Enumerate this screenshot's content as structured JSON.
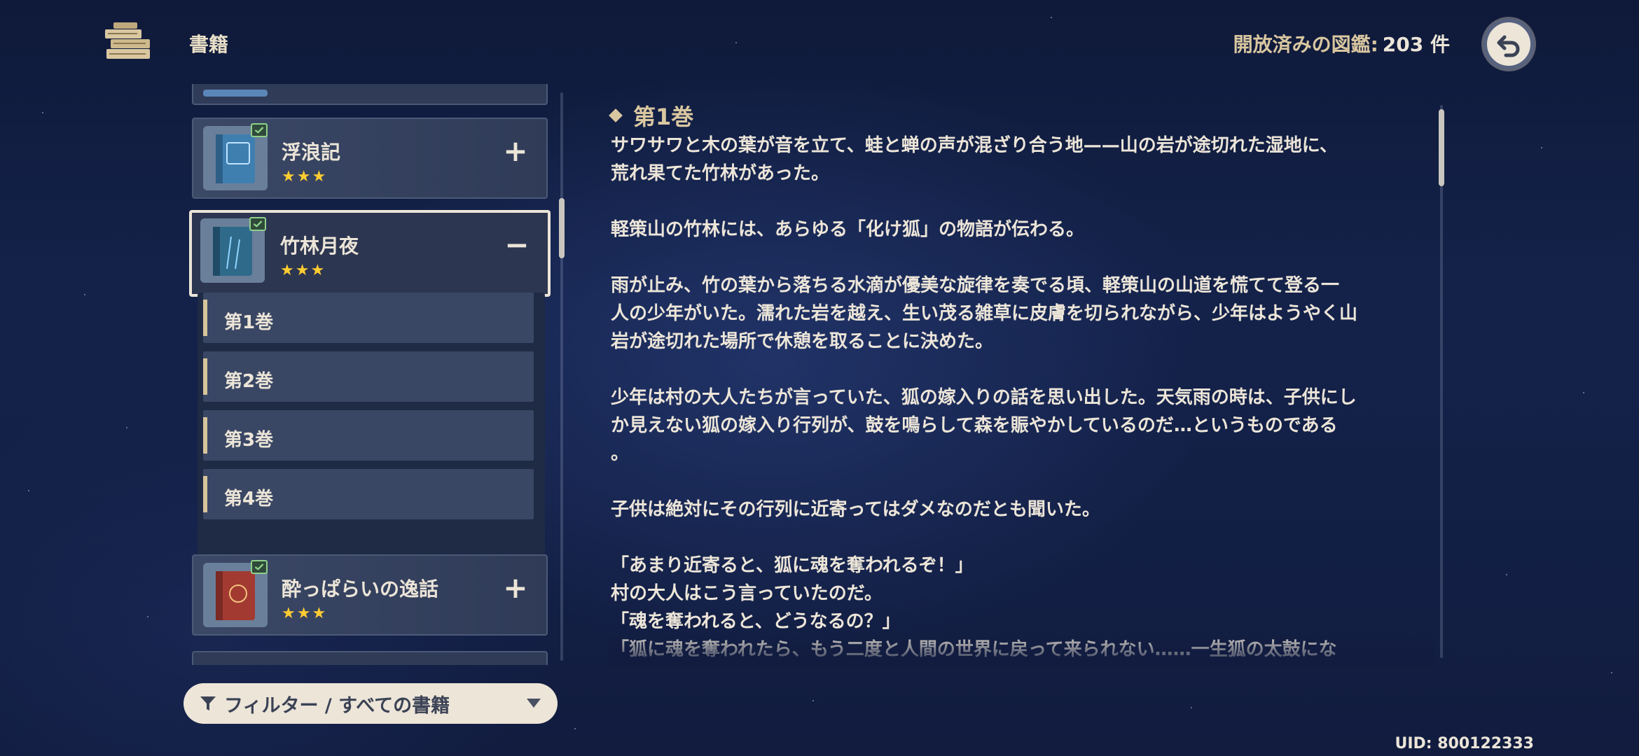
{
  "header": {
    "title": "書籍",
    "unlocked_label": "開放済みの図鑑:",
    "unlocked_count": "203 件"
  },
  "book_list": {
    "books": [
      {
        "title": "浮浪記",
        "stars": "★★★",
        "toggle": "+",
        "cover_color": "#3f7fb0",
        "expanded": false
      },
      {
        "title": "竹林月夜",
        "stars": "★★★",
        "toggle": "−",
        "cover_color": "#2f6a8a",
        "expanded": true
      },
      {
        "title": "酔っぱらいの逸話",
        "stars": "★★★",
        "toggle": "+",
        "cover_color": "#a23a32",
        "expanded": false
      }
    ],
    "chapters": [
      "第1巻",
      "第2巻",
      "第3巻",
      "第4巻"
    ]
  },
  "filter": {
    "label": "フィルター / すべての書籍"
  },
  "reader": {
    "chapter_title": "第1巻",
    "paragraphs": [
      "サワサワと木の葉が音を立て、蛙と蝉の声が混ざり合う地——山の岩が途切れた湿地に、\n荒れ果てた竹林があった。",
      "軽策山の竹林には、あらゆる「化け狐」の物語が伝わる。",
      "雨が止み、竹の葉から落ちる水滴が優美な旋律を奏でる頃、軽策山の山道を慌てて登る一\n人の少年がいた。濡れた岩を越え、生い茂る雑草に皮膚を切られながら、少年はようやく山\n岩が途切れた場所で休憩を取ることに決めた。",
      "少年は村の大人たちが言っていた、狐の嫁入りの話を思い出した。天気雨の時は、子供にし\nか見えない狐の嫁入り行列が、鼓を鳴らして森を賑やかしているのだ…というものである\n。",
      "子供は絶対にその行列に近寄ってはダメなのだとも聞いた。",
      "「あまり近寄ると、狐に魂を奪われるぞ！」\n村の大人はこう言っていたのだ。\n「魂を奪われると、どうなるの？」\n「狐に魂を奪われたら、もう二度と人間の世界に戻って来られない……一生狐の太鼓にな\nって、殴られたり、打たれたりして暮らすんだ……」"
    ]
  },
  "uid": "UID: 800122333",
  "colors": {
    "accent_gold": "#d9c7a0",
    "star_yellow": "#ffcc32",
    "text_light": "#ece5d8",
    "panel": "#3b4866"
  },
  "icons": [
    "bookshelf-icon",
    "back-arrow-icon",
    "book-cover-icon",
    "read-check-icon",
    "plus-icon",
    "minus-icon",
    "filter-icon",
    "caret-down-icon"
  ]
}
